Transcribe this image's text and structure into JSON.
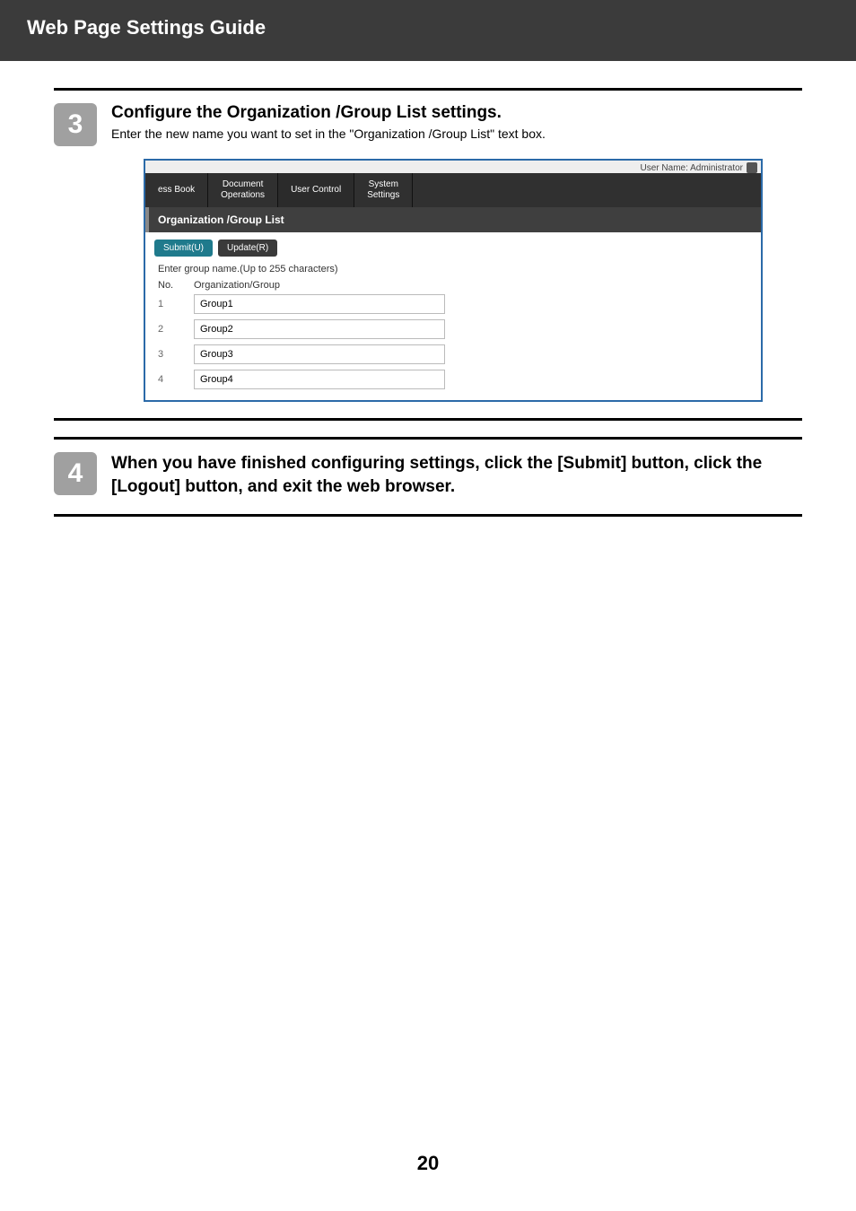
{
  "header": {
    "title": "Web Page Settings Guide"
  },
  "step3": {
    "number": "3",
    "title": "Configure the Organization /Group List settings.",
    "desc": "Enter the new name you want to set in the \"Organization /Group List\" text box."
  },
  "screenshot": {
    "user_label": "User Name: Administrator",
    "tabs": {
      "ess_book": "ess Book",
      "doc_ops_1": "Document",
      "doc_ops_2": "Operations",
      "user_control": "User Control",
      "sys_1": "System",
      "sys_2": "Settings"
    },
    "section_title": "Organization /Group List",
    "buttons": {
      "submit": "Submit(U)",
      "update": "Update(R)"
    },
    "hint": "Enter group name.(Up to 255 characters)",
    "table": {
      "col_no": "No.",
      "col_org": "Organization/Group",
      "rows": [
        {
          "no": "1",
          "val": "Group1"
        },
        {
          "no": "2",
          "val": "Group2"
        },
        {
          "no": "3",
          "val": "Group3"
        },
        {
          "no": "4",
          "val": "Group4"
        }
      ]
    }
  },
  "step4": {
    "number": "4",
    "title": "When you have finished configuring settings, click the [Submit] button, click the [Logout] button, and exit the web browser."
  },
  "page_number": "20"
}
